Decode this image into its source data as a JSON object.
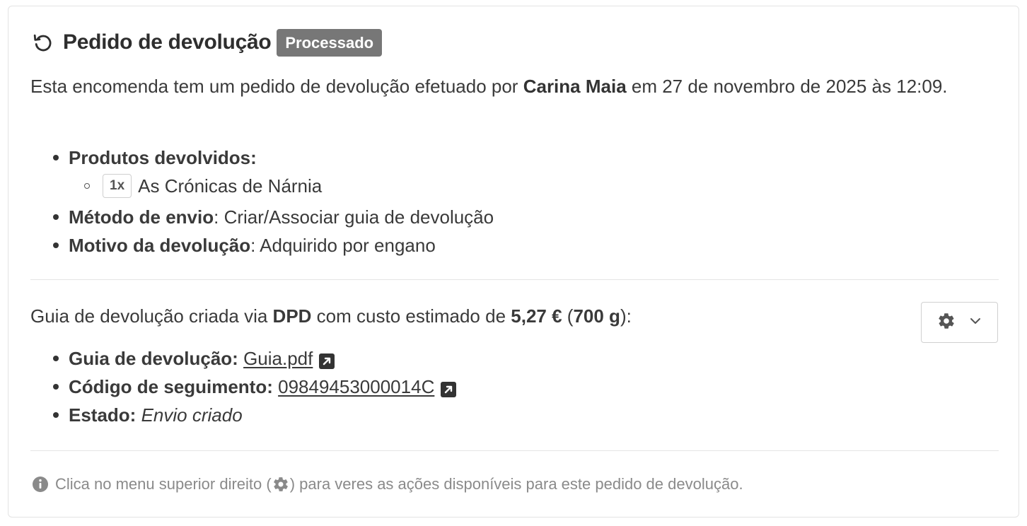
{
  "header": {
    "title": "Pedido de devolução",
    "badge": "Processado"
  },
  "intro": {
    "prefix": "Esta encomenda tem um pedido de devolução efetuado por ",
    "customer": "Carina Maia",
    "suffix": " em 27 de novembro de 2025 às 12:09."
  },
  "details": {
    "products_label": "Produtos devolvidos:",
    "products": [
      {
        "qty": "1x",
        "name": "As Crónicas de Nárnia"
      }
    ],
    "shipping_label": "Método de envio",
    "shipping_value": ": Criar/Associar guia de devolução",
    "reason_label": "Motivo da devolução",
    "reason_value": ": Adquirido por engano"
  },
  "label_info": {
    "prefix": "Guia de devolução criada via ",
    "carrier": "DPD",
    "middle": " com custo estimado de ",
    "cost": "5,27 €",
    "open_paren": " (",
    "weight": "700 g",
    "close": "):",
    "guide_label": "Guia de devolução:",
    "guide_link": "Guia.pdf",
    "tracking_label": "Código de seguimento:",
    "tracking_link": "09849453000014C",
    "status_label": "Estado:",
    "status_value": "Envio criado"
  },
  "actions": {
    "gear_icon": "gear-icon",
    "chevron_icon": "chevron-down-icon"
  },
  "footer": {
    "info_before": "Clica no menu superior direito (",
    "info_after": ") para veres as ações disponíveis para este pedido de devolução."
  }
}
